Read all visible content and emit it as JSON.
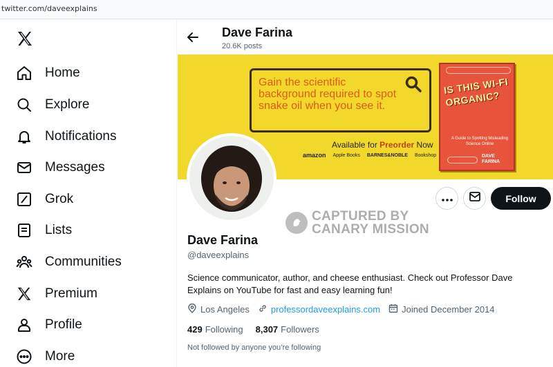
{
  "browser": {
    "url": "twitter.com/daveexplains"
  },
  "sidebar": {
    "logo_icon": "x-logo-icon",
    "items": [
      {
        "label": "Home",
        "icon": "home-icon"
      },
      {
        "label": "Explore",
        "icon": "search-icon"
      },
      {
        "label": "Notifications",
        "icon": "bell-icon"
      },
      {
        "label": "Messages",
        "icon": "envelope-icon"
      },
      {
        "label": "Grok",
        "icon": "grok-icon"
      },
      {
        "label": "Lists",
        "icon": "list-icon"
      },
      {
        "label": "Communities",
        "icon": "communities-icon"
      },
      {
        "label": "Premium",
        "icon": "x-logo-icon"
      },
      {
        "label": "Profile",
        "icon": "person-icon"
      },
      {
        "label": "More",
        "icon": "more-circle-icon"
      }
    ]
  },
  "header": {
    "name": "Dave Farina",
    "posts": "20.6K posts"
  },
  "banner": {
    "headline": "Gain the scientific background required to spot snake oil when you see it.",
    "avail_prefix": "Available for",
    "avail_bold": "Preorder",
    "avail_suffix": "Now",
    "stores": [
      "amazon",
      "Apple Books",
      "BARNES&NOBLE",
      "Bookshop"
    ],
    "book_title": "IS THIS WI-FI ORGANIC?",
    "book_subtitle": "A Guide to Spotting Misleading Science Online",
    "book_author": "DAVE FARINA"
  },
  "actions": {
    "follow_label": "Follow"
  },
  "watermark": {
    "line1": "CAPTURED BY",
    "line2": "CANARY MISSION"
  },
  "profile": {
    "display_name": "Dave Farina",
    "handle": "@daveexplains",
    "bio": "Science communicator, author, and cheese enthusiast. Check out Professor Dave Explains on YouTube for fast and easy learning fun!",
    "location": "Los Angeles",
    "website": "professordaveexplains.com",
    "joined": "Joined December 2014",
    "following_count": "429",
    "following_label": "Following",
    "followers_count": "8,307",
    "followers_label": "Followers",
    "not_followed": "Not followed by anyone you’re following"
  },
  "colors": {
    "banner_bg": "#f2d82b",
    "accent_link": "#1d9bf0",
    "follow_btn": "#0f1419",
    "headline": "#e05a17"
  }
}
